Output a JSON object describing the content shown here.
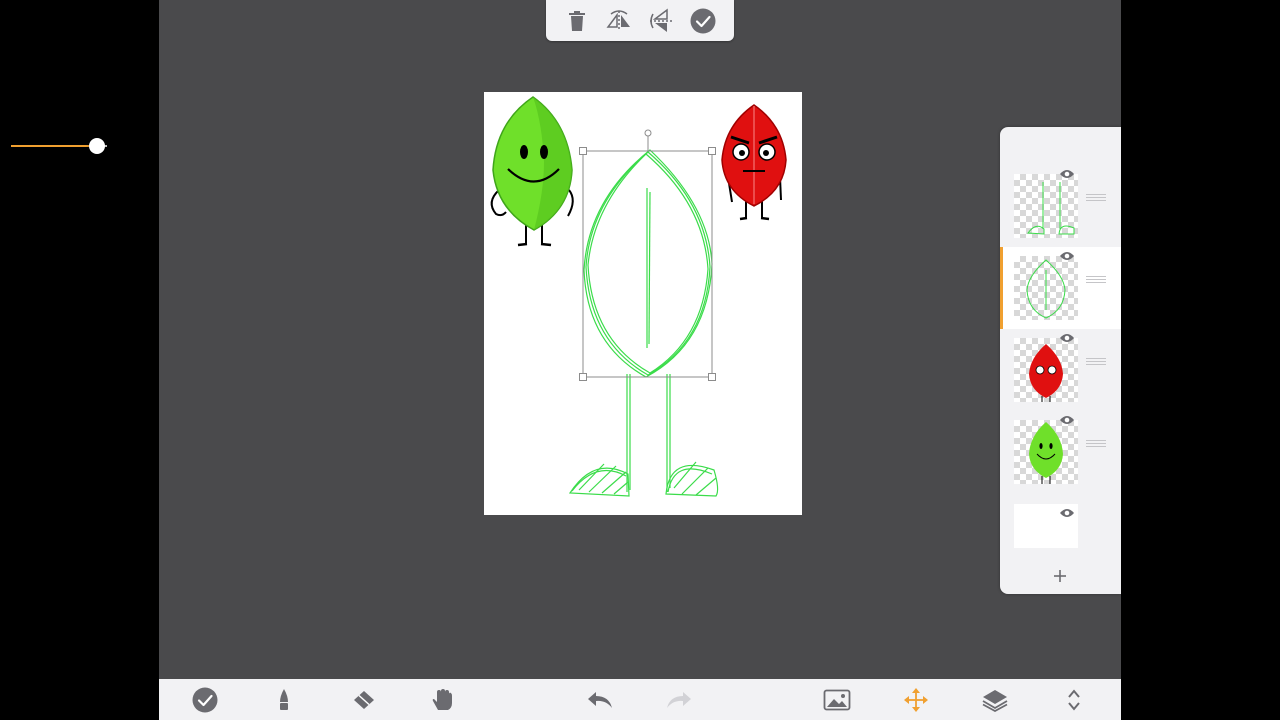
{
  "colors": {
    "workspace": "#4a4a4c",
    "panel": "#f2f2f4",
    "accent": "#f0a030",
    "icon": "#6b6b70",
    "sketch_green": "#3bdc4a",
    "leafy_green": "#6fe02a",
    "evil_red": "#e01010"
  },
  "transform_toolbar": {
    "icons": [
      "trash-icon",
      "flip-horizontal-icon",
      "flip-vertical-icon",
      "confirm-check-icon"
    ]
  },
  "layers": {
    "opacity_fraction": 0.9,
    "selected_index": 1,
    "items": [
      {
        "name": "layer-legs",
        "visible": true
      },
      {
        "name": "layer-body-sketch",
        "visible": true
      },
      {
        "name": "layer-red-character",
        "visible": true
      },
      {
        "name": "layer-green-character",
        "visible": true
      },
      {
        "name": "layer-background",
        "visible": true
      }
    ]
  },
  "bottom_toolbar": {
    "icons": [
      "check-circle-icon",
      "brush-icon",
      "eraser-icon",
      "hand-icon",
      "undo-icon",
      "redo-icon",
      "image-icon",
      "move-icon",
      "layers-icon",
      "expand-icon"
    ]
  }
}
